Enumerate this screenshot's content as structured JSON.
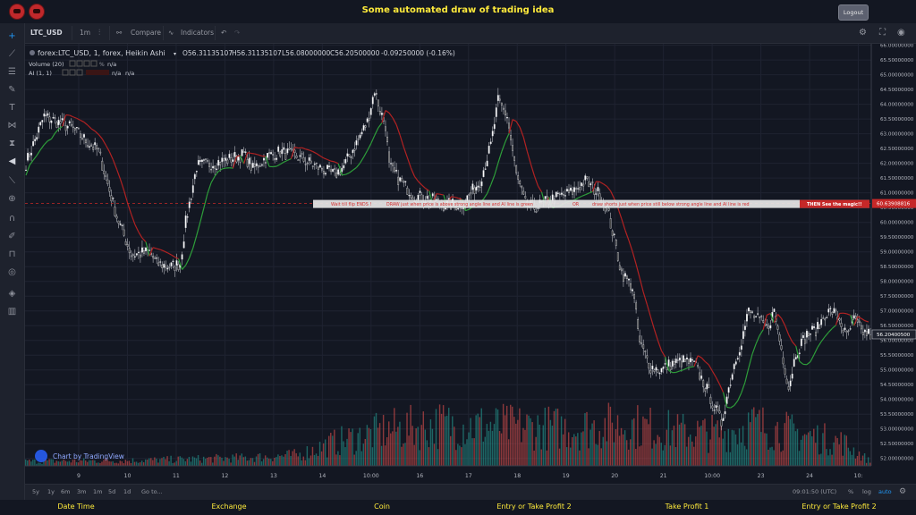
{
  "header": {
    "title": "Some automated draw of trading idea",
    "logout_label": "Logout"
  },
  "toolbar": {
    "symbol": "LTC_USD",
    "interval": "1m",
    "compare_label": "Compare",
    "indicators_label": "Indicators"
  },
  "legend": {
    "main": "forex:LTC_USD, 1, forex, Heikin Ashi",
    "open": "O56.31135107",
    "high": "H56.31135107",
    "low": "L56.08000000",
    "close": "C56.20500000",
    "change": "-0.09250000 (-0.16%)",
    "volume_label": "Volume (20)",
    "volume_value": "n/a",
    "volume_small": "%",
    "ai_label": "AI (1, 1)",
    "ai_value_a": "n/a",
    "ai_value_b": "n/a"
  },
  "watermark": "Chart by TradingView",
  "bottombar": {
    "ranges": [
      "5y",
      "1y",
      "6m",
      "3m",
      "1m",
      "5d",
      "1d"
    ],
    "goto_label": "Go to...",
    "time": "09:01:50 (UTC)",
    "percent_label": "%",
    "log_label": "log",
    "auto_label": "auto"
  },
  "footer": {
    "labels": [
      "Date Time",
      "Exchange",
      "Coin",
      "Entry or Take Profit 2",
      "Take Profit 1",
      "Entry or Take Profit 2"
    ]
  },
  "chart_data": {
    "type": "candlestick",
    "symbol": "forex:LTC_USD",
    "ylim": [
      51.75,
      66.05
    ],
    "yticks": [
      52,
      52.5,
      53,
      53.5,
      54,
      54.5,
      55,
      55.5,
      56,
      56.5,
      57,
      57.5,
      58,
      58.5,
      59,
      59.5,
      60,
      60.5,
      61,
      61.5,
      62,
      62.5,
      63,
      63.5,
      64,
      64.5,
      65,
      65.5,
      66
    ],
    "yaxis_decimals": 8,
    "xticks": [
      "9",
      "10",
      "11",
      "12",
      "13",
      "14",
      "10:00",
      "16",
      "17",
      "18",
      "19",
      "20",
      "21",
      "10:00",
      "23",
      "24",
      "10:"
    ],
    "last_price": 56.20405,
    "last_price_label": "56.20400500",
    "marker_price": 60.63908816,
    "marker_label": "60.63908816",
    "annotation": {
      "segments": [
        "Wait till flip ENDS  !",
        "DRAW just when  price is above strong angle line and AI line is green",
        "OR",
        "draw shorts just when price still below strong angle line and AI line is red"
      ],
      "final": "THEN See the magic!!",
      "colors": {
        "box_bg": "#e6e6e6",
        "text": "#d32f2f",
        "final_bg": "#c62828",
        "final_text": "#ffffff"
      }
    },
    "close_keyframes": [
      [
        0,
        62.0
      ],
      [
        10,
        63.6
      ],
      [
        25,
        63.2
      ],
      [
        40,
        62.4
      ],
      [
        50,
        60.2
      ],
      [
        58,
        58.9
      ],
      [
        68,
        59.0
      ],
      [
        72,
        58.6
      ],
      [
        80,
        58.5
      ],
      [
        85,
        58.6
      ],
      [
        88,
        60.0
      ],
      [
        94,
        61.9
      ],
      [
        110,
        62.1
      ],
      [
        120,
        62.3
      ],
      [
        125,
        61.8
      ],
      [
        132,
        62.2
      ],
      [
        140,
        62.4
      ],
      [
        150,
        62.2
      ],
      [
        160,
        61.9
      ],
      [
        170,
        61.6
      ],
      [
        175,
        61.9
      ],
      [
        182,
        62.7
      ],
      [
        188,
        63.4
      ],
      [
        192,
        64.5
      ],
      [
        195,
        63.8
      ],
      [
        198,
        63.3
      ],
      [
        200,
        61.9
      ],
      [
        206,
        61.4
      ],
      [
        214,
        60.9
      ],
      [
        222,
        60.8
      ],
      [
        230,
        60.6
      ],
      [
        240,
        60.6
      ],
      [
        250,
        61.4
      ],
      [
        256,
        62.6
      ],
      [
        260,
        64.1
      ],
      [
        265,
        63.6
      ],
      [
        270,
        61.6
      ],
      [
        275,
        60.6
      ],
      [
        280,
        60.5
      ],
      [
        290,
        60.8
      ],
      [
        300,
        61.0
      ],
      [
        308,
        61.4
      ],
      [
        315,
        61.0
      ],
      [
        320,
        60.5
      ],
      [
        328,
        58.3
      ],
      [
        334,
        57.8
      ],
      [
        338,
        55.9
      ],
      [
        344,
        55.1
      ],
      [
        350,
        55.0
      ],
      [
        355,
        55.2
      ],
      [
        362,
        55.3
      ],
      [
        368,
        55.2
      ],
      [
        372,
        54.7
      ],
      [
        376,
        54.2
      ],
      [
        380,
        53.6
      ],
      [
        383,
        53.2
      ],
      [
        386,
        54.1
      ],
      [
        390,
        55.2
      ],
      [
        394,
        56.0
      ],
      [
        398,
        57.0
      ],
      [
        403,
        56.7
      ],
      [
        408,
        56.4
      ],
      [
        412,
        57.0
      ],
      [
        416,
        55.7
      ],
      [
        420,
        54.4
      ],
      [
        424,
        55.6
      ],
      [
        430,
        56.2
      ],
      [
        436,
        56.4
      ],
      [
        440,
        56.9
      ],
      [
        444,
        57.0
      ],
      [
        448,
        56.7
      ],
      [
        452,
        56.1
      ],
      [
        456,
        56.7
      ],
      [
        460,
        56.3
      ],
      [
        465,
        56.2
      ]
    ],
    "volume_keyframes": [
      [
        0,
        0.5
      ],
      [
        60,
        0.6
      ],
      [
        120,
        0.9
      ],
      [
        150,
        1.2
      ],
      [
        170,
        2.6
      ],
      [
        200,
        4.0
      ],
      [
        230,
        4.6
      ],
      [
        260,
        4.4
      ],
      [
        300,
        4.2
      ],
      [
        330,
        4.6
      ],
      [
        360,
        3.8
      ],
      [
        383,
        3.6
      ],
      [
        400,
        4.6
      ],
      [
        430,
        3.4
      ],
      [
        450,
        2.6
      ],
      [
        465,
        0.5
      ]
    ],
    "volume_max": 9,
    "series": [
      {
        "name": "Heikin Ashi candles",
        "up_color": "#ffffff",
        "down_color": "#2c2c2c"
      },
      {
        "name": "AI line",
        "up_color": "#2e9e3a",
        "down_color": "#b22222"
      },
      {
        "name": "Volume",
        "up_color": "#26a69a",
        "down_color": "#ef5350"
      }
    ],
    "grid": true,
    "bg_color": "#131722"
  }
}
